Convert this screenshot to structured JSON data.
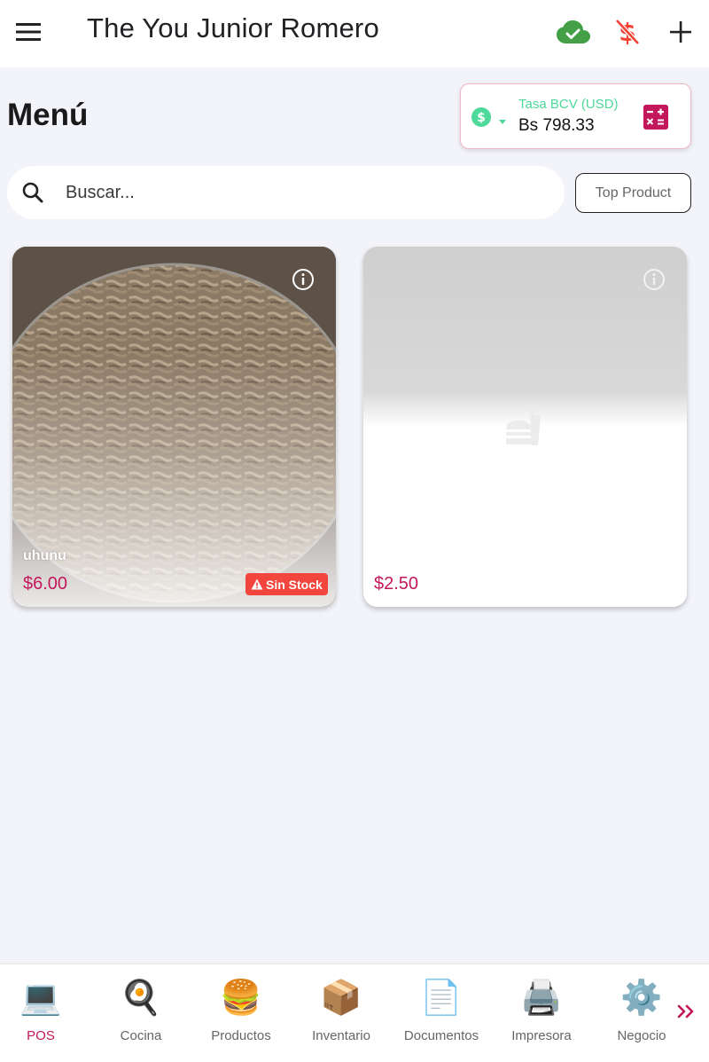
{
  "app_bar": {
    "title": "The You Junior Romero",
    "menu_icon": "hamburger-menu-icon",
    "sync_icon": "cloud-done-icon",
    "currency_off_icon": "money-off-icon",
    "add_icon": "plus-icon"
  },
  "page": {
    "title": "Menú"
  },
  "rate": {
    "label": "Tasa BCV (USD)",
    "value": "Bs 798.33",
    "colors": {
      "label": "#4cd99a",
      "border": "#f1b6c8",
      "calc": "#c2185b"
    }
  },
  "search": {
    "placeholder": "Buscar...",
    "value": ""
  },
  "filters": {
    "top_product_label": "Top Product"
  },
  "products": [
    {
      "name": "uhunu",
      "price": "$6.00",
      "badge": "Sin Stock",
      "has_image": true
    },
    {
      "name": "",
      "price": "$2.50",
      "badge": "",
      "has_image": false
    }
  ],
  "bottom_nav": {
    "items": [
      {
        "label": "POS",
        "icon": "laptop-icon",
        "glyph": "💻",
        "active": true
      },
      {
        "label": "Cocina",
        "icon": "frying-pan-icon",
        "glyph": "🍳",
        "active": false
      },
      {
        "label": "Productos",
        "icon": "burger-icon",
        "glyph": "🍔",
        "active": false
      },
      {
        "label": "Inventario",
        "icon": "package-icon",
        "glyph": "📦",
        "active": false
      },
      {
        "label": "Documentos",
        "icon": "document-icon",
        "glyph": "📄",
        "active": false
      },
      {
        "label": "Impresora",
        "icon": "printer-icon",
        "glyph": "🖨️",
        "active": false
      },
      {
        "label": "Negocio",
        "icon": "gear-icon",
        "glyph": "⚙️",
        "active": false
      }
    ],
    "more_icon": "double-chevron-right-icon"
  },
  "colors": {
    "accent": "#c2185b",
    "background": "#f3f4f9",
    "danger": "#f1453d",
    "success": "#43a047"
  }
}
